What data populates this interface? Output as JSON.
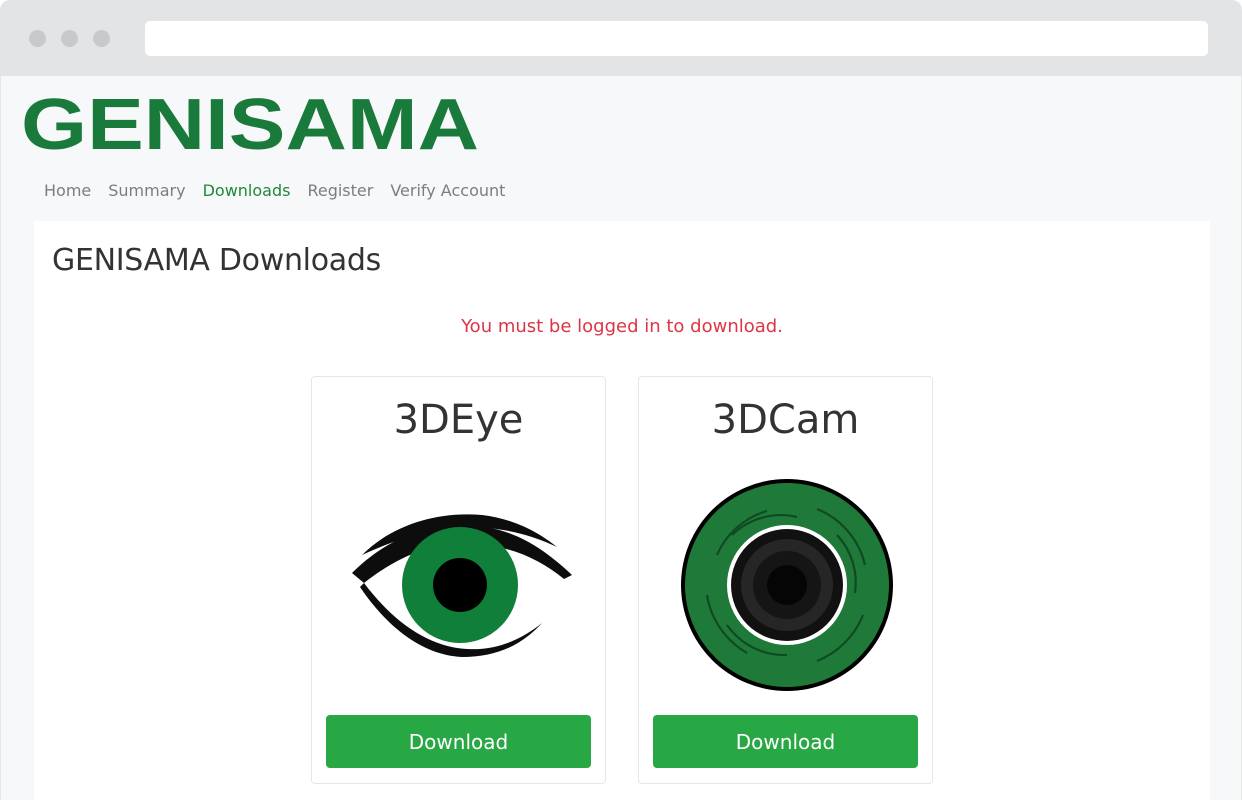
{
  "brand": {
    "logo_text": "GENISAMA",
    "color": "#1a7a3c"
  },
  "nav": {
    "items": [
      {
        "label": "Home",
        "active": false
      },
      {
        "label": "Summary",
        "active": false
      },
      {
        "label": "Downloads",
        "active": true
      },
      {
        "label": "Register",
        "active": false
      },
      {
        "label": "Verify Account",
        "active": false
      }
    ]
  },
  "main": {
    "title": "GENISAMA Downloads",
    "alert": "You must be logged in to download.",
    "alert_color": "#dc3545",
    "cards": [
      {
        "title": "3DEye",
        "image": "eye-icon",
        "button_label": "Download"
      },
      {
        "title": "3DCam",
        "image": "camera-lens-icon",
        "button_label": "Download"
      }
    ],
    "button_color": "#28a745"
  }
}
